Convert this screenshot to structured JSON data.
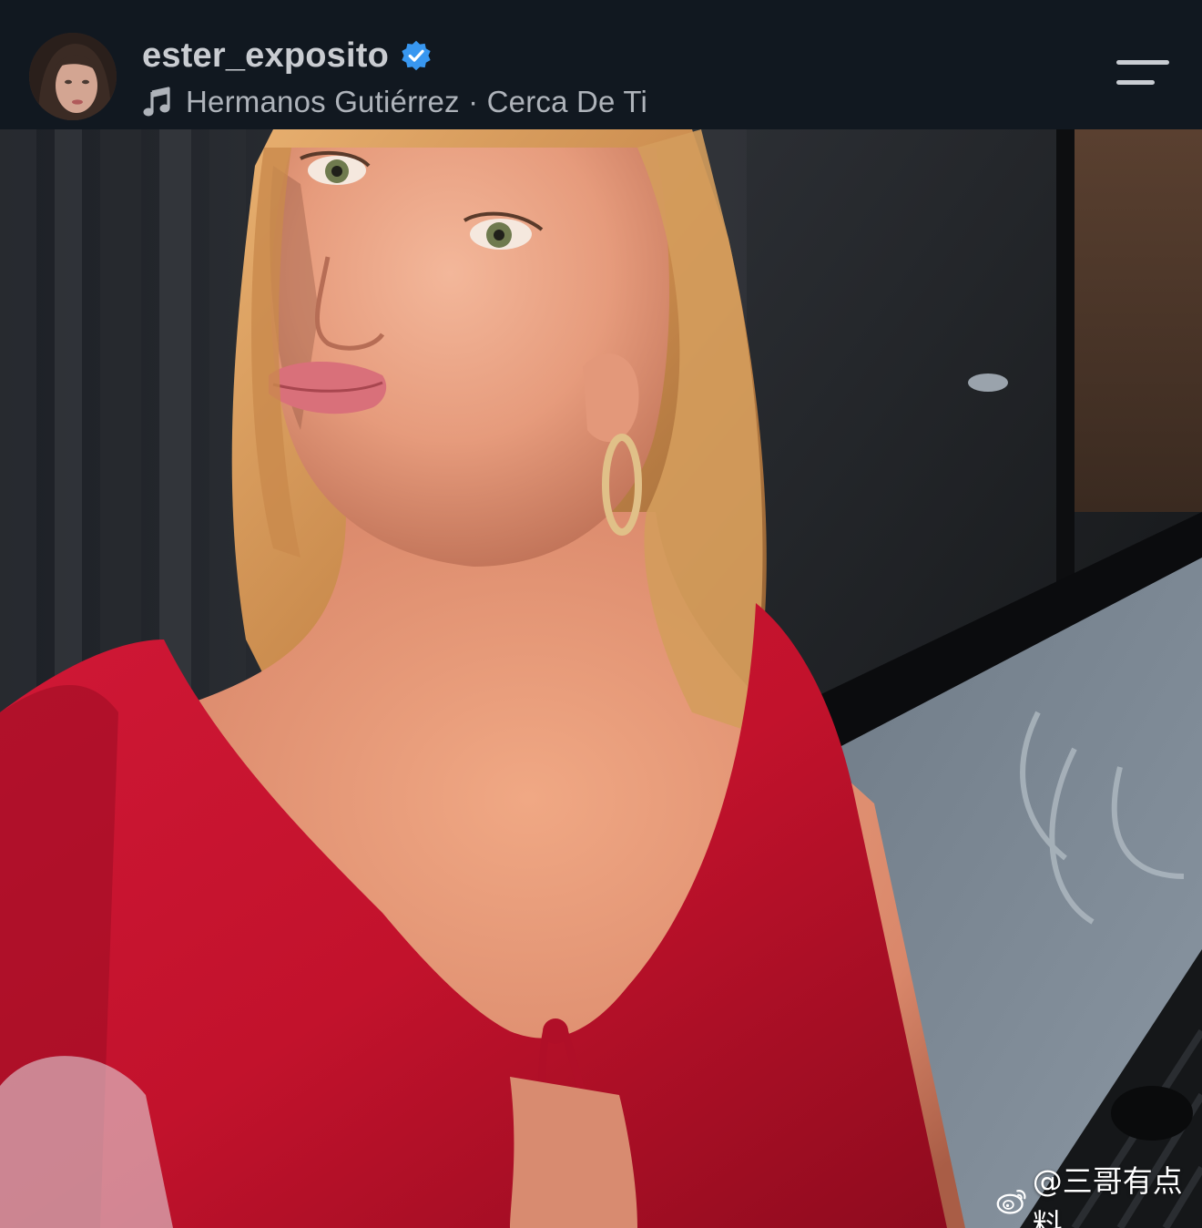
{
  "header": {
    "username": "ester_exposito",
    "verified": true,
    "music": {
      "artist": "Hermanos Gutiérrez",
      "separator": "·",
      "track": "Cerca De Ti",
      "label": "Hermanos Gutiérrez · Cerca De Ti"
    },
    "icons": {
      "avatar": "profile-avatar",
      "badge": "verified-badge-icon",
      "music": "music-note-icon",
      "menu": "menu-icon"
    }
  },
  "watermark": {
    "text": "@三哥有点料",
    "icon": "weibo-icon"
  },
  "colors": {
    "header_bg": "#111820",
    "username": "#c9ccd1",
    "verified_blue": "#3897f0",
    "dress_red": "#c8102e"
  }
}
